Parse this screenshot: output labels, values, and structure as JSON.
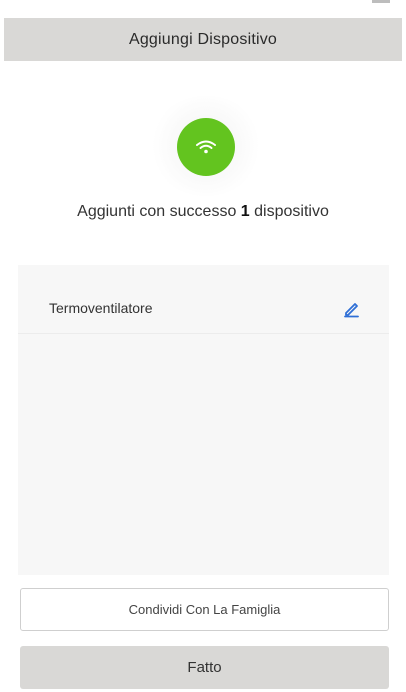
{
  "header": {
    "title": "Aggiungi Dispositivo"
  },
  "status": {
    "icon": "wifi-icon",
    "icon_color": "#63c41f",
    "text_before": "Aggiunti con successo ",
    "count": "1",
    "text_after": " dispositivo"
  },
  "devices": [
    {
      "name": "Termoventilatore",
      "edit_icon": "pencil-icon",
      "edit_color": "#2f6fd6"
    }
  ],
  "actions": {
    "share_label": "Condividi Con La Famiglia",
    "done_label": "Fatto"
  },
  "colors": {
    "header_bg": "#d9d8d6",
    "panel_bg": "#f7f7f7",
    "button_bg": "#d9d8d6"
  }
}
